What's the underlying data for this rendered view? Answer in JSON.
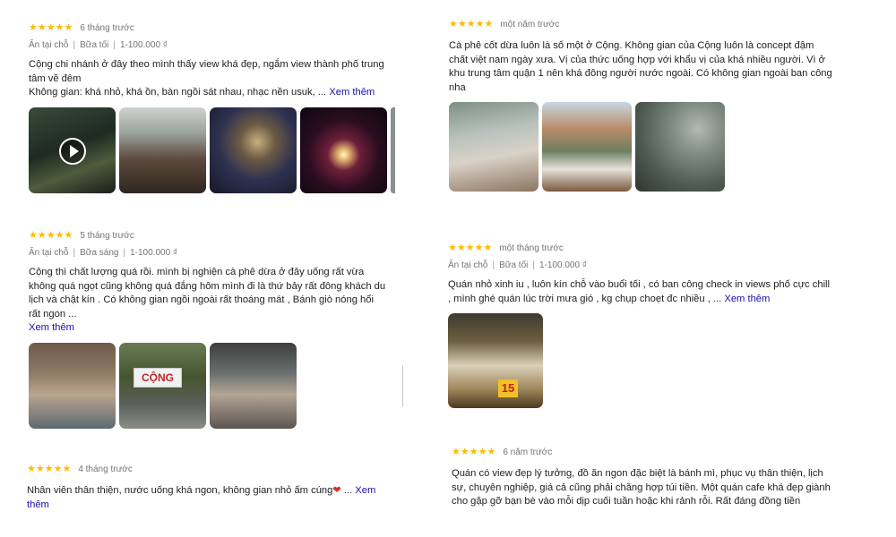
{
  "reviews": [
    {
      "stars": "★★★★★",
      "time": "6 tháng trước",
      "attrs": [
        "Ăn tại chỗ",
        "Bữa tối",
        "1-100.000 ₫"
      ],
      "text": "Cộng chi nhánh ở đây theo mình thấy view khá đẹp, ngắm view thành phố trung tâm về đêm",
      "text2": "Không gian: khá nhỏ, khá ồn, bàn ngồi sát nhau, nhạc nền usuk, ...",
      "more": "Xem thêm"
    },
    {
      "stars": "★★★★★",
      "time": "một năm trước",
      "text": "Cà phê cốt dừa luôn là số một ở Cộng. Không gian của Cộng luôn là concept đậm chất việt nam ngày xưa. Vị của thức uống hợp với khẩu vị của khá nhiều người. Vì ở khu trung tâm quận 1 nên khá đông người nước ngoài. Có không gian ngoài ban công nha"
    },
    {
      "stars": "★★★★★",
      "time": "5 tháng trước",
      "attrs": [
        "Ăn tại chỗ",
        "Bữa sáng",
        "1-100.000 ₫"
      ],
      "text": "Cộng thì chất lượng quá rồi. mình bị nghiện cà phê dừa ở đây uống rất vừa không quá ngọt cũng không quá đắng hôm mình đi là thứ bảy rất đông khách du lịch và chật kín . Có không gian ngồi ngoài rất thoáng mát , Bánh giò nóng hổi rất ngon ...",
      "more": "Xem thêm",
      "sign_text": "CỘNG"
    },
    {
      "stars": "★★★★★",
      "time": "một tháng trước",
      "attrs": [
        "Ăn tại chỗ",
        "Bữa tối",
        "1-100.000 ₫"
      ],
      "text": "Quán nhỏ xinh iu , luôn kín chỗ vào buổi tối , có ban công check in views phố cực chill , mình ghé quán lúc trời mưa gió , kg chụp choẹt đc nhiều , ...",
      "more": "Xem thêm",
      "badge_text": "15"
    },
    {
      "stars": "★★★★★",
      "time": "4 tháng trước",
      "text": "Nhân viên thân thiện, nước uống khá ngon, không gian nhỏ ấm cúng",
      "heart": "❤",
      "ellipsis": "...",
      "more": "Xem thêm"
    },
    {
      "stars": "★★★★★",
      "time": "6 năm trước",
      "text": "Quán có view đẹp lý tưởng, đồ ăn ngon đặc biệt là bánh mì, phục vụ thân thiện, lịch sự, chuyên nghiệp, giá cả cũng phải chăng hợp túi tiền. Một quán cafe khá đẹp giành cho gặp gỡ bạn bè vào mỗi dịp cuối tuần hoặc khi rảnh rỗi. Rất đáng đồng tiền"
    }
  ],
  "colors": {
    "stars": "#fbbc04",
    "link": "#1a0dab",
    "meta": "#70757a",
    "text": "#202124"
  }
}
